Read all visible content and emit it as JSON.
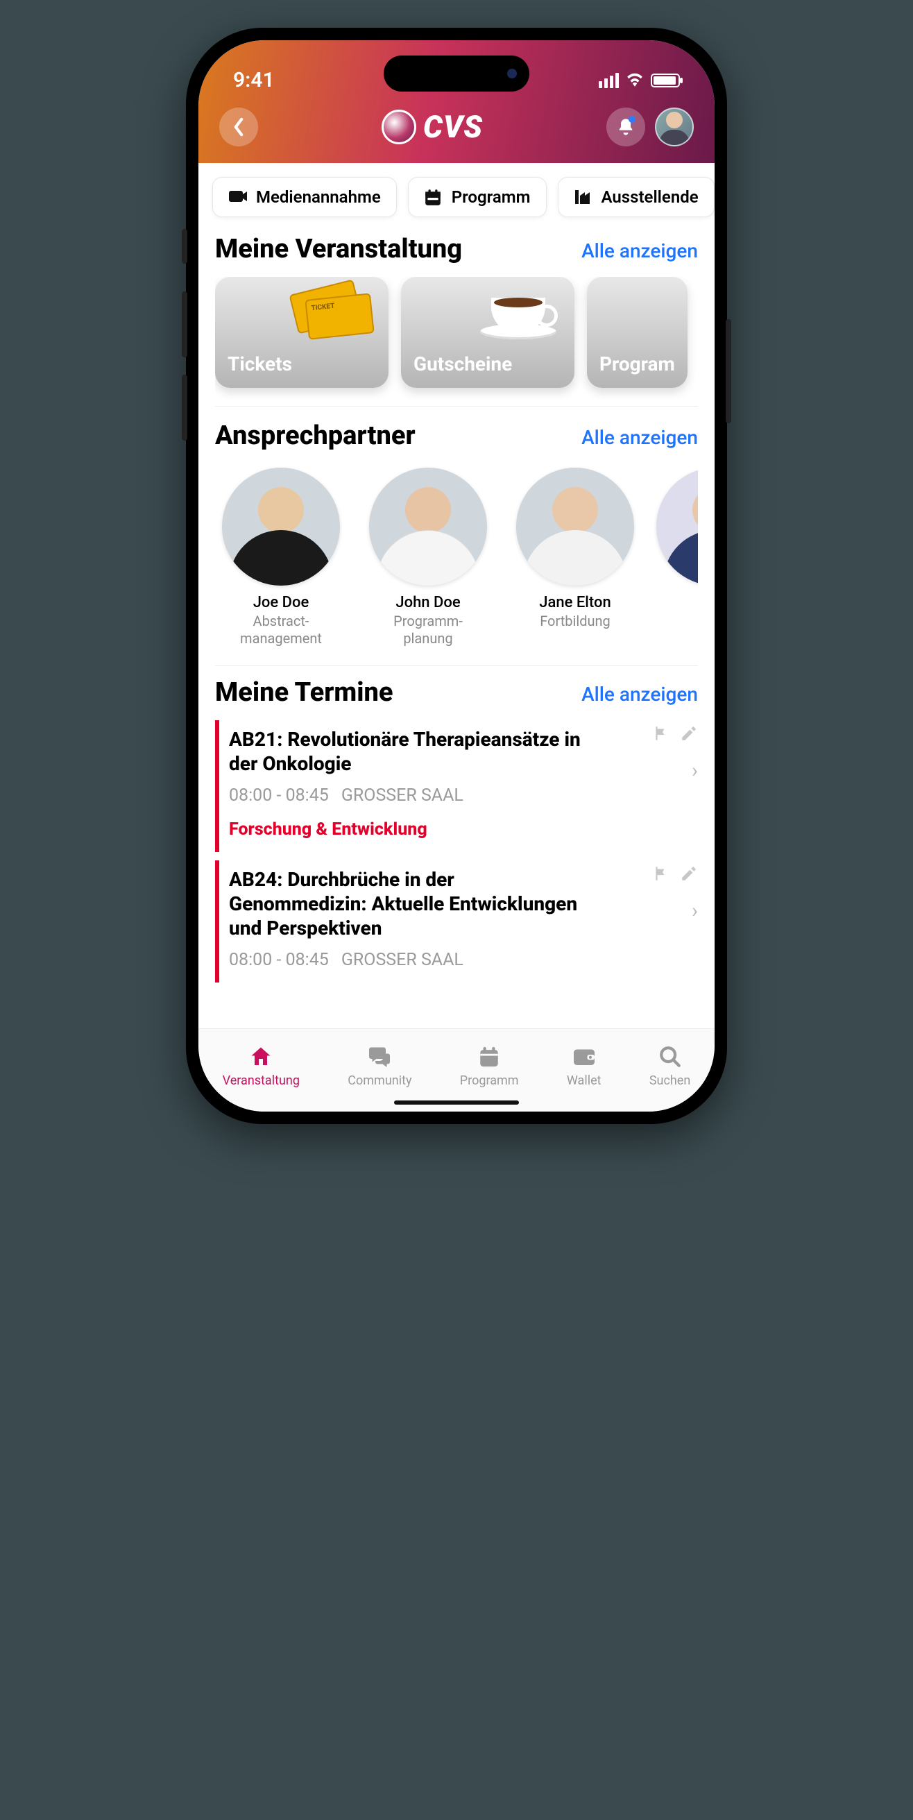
{
  "status": {
    "time": "9:41"
  },
  "header": {
    "logo_text": "CVS"
  },
  "chips": [
    {
      "label": "Medienannahme",
      "icon": "camera-icon"
    },
    {
      "label": "Programm",
      "icon": "calendar-icon"
    },
    {
      "label": "Ausstellende",
      "icon": "factory-icon"
    }
  ],
  "my_event": {
    "title": "Meine Veranstaltung",
    "show_all": "Alle anzeigen",
    "cards": [
      {
        "label": "Tickets"
      },
      {
        "label": "Gutscheine"
      },
      {
        "label": "Program"
      }
    ]
  },
  "contacts": {
    "title": "Ansprechpartner",
    "show_all": "Alle anzeigen",
    "items": [
      {
        "name": "Joe Doe",
        "role": "Abstract-\nmanagement"
      },
      {
        "name": "John Doe",
        "role": "Programm-\nplanung"
      },
      {
        "name": "Jane Elton",
        "role": "Fortbildung"
      }
    ]
  },
  "appointments": {
    "title": "Meine Termine",
    "show_all": "Alle anzeigen",
    "items": [
      {
        "title": "AB21: Revolutionäre Therapieansätze in der Onkologie",
        "time": "08:00 - 08:45",
        "room": "GROSSER SAAL",
        "tag": "Forschung & Entwicklung"
      },
      {
        "title": "AB24: Durchbrüche in der Genommedizin: Aktuelle Entwicklungen und Perspektiven",
        "time": "08:00 - 08:45",
        "room": "GROSSER SAAL",
        "tag": ""
      }
    ]
  },
  "tabs": [
    {
      "label": "Veranstaltung",
      "icon": "home-icon",
      "active": true
    },
    {
      "label": "Community",
      "icon": "chat-icon",
      "active": false
    },
    {
      "label": "Programm",
      "icon": "calendar-icon",
      "active": false
    },
    {
      "label": "Wallet",
      "icon": "wallet-icon",
      "active": false
    },
    {
      "label": "Suchen",
      "icon": "search-icon",
      "active": false
    }
  ]
}
